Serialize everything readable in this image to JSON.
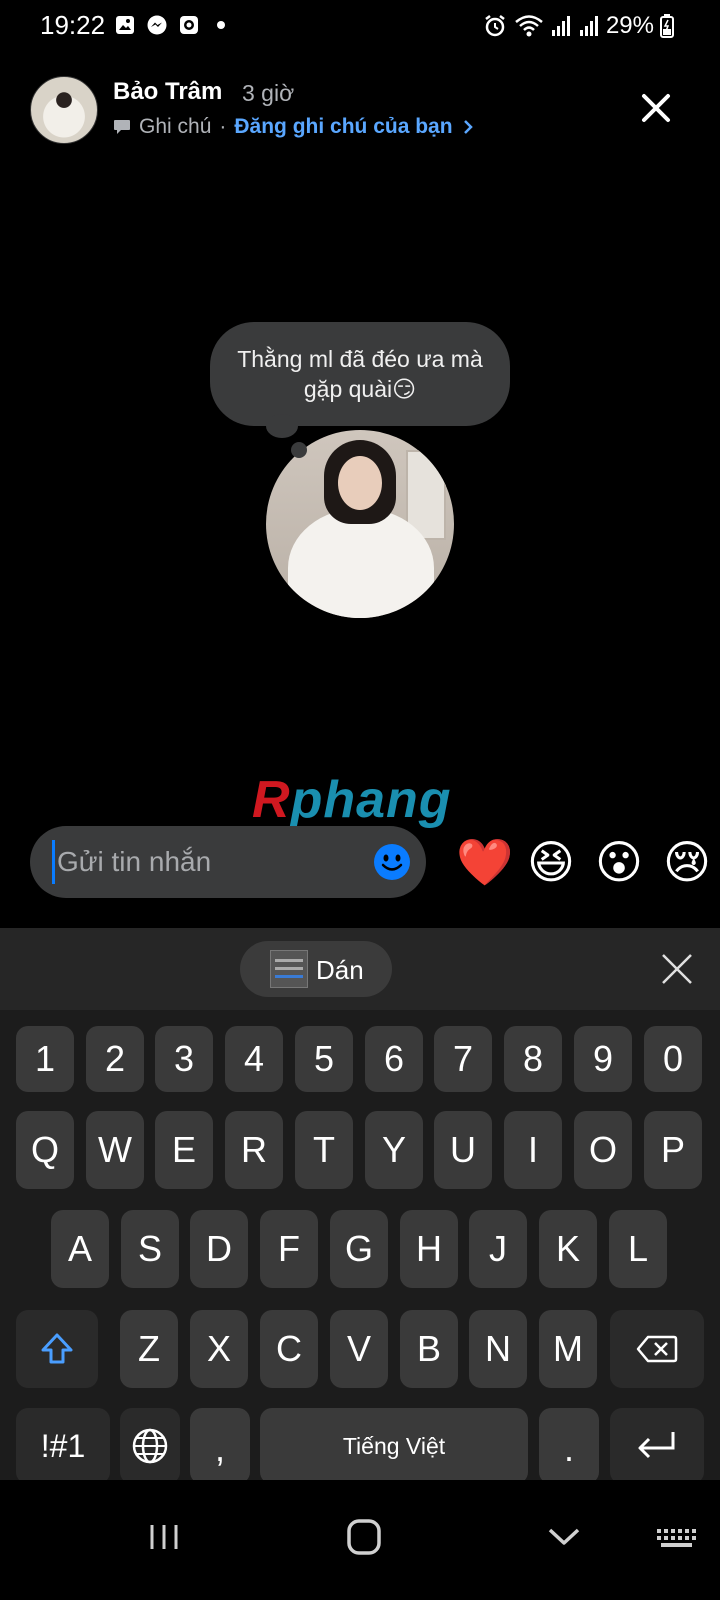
{
  "status_bar": {
    "time": "19:22",
    "battery": "29%"
  },
  "header": {
    "name": "Bảo Trâm",
    "time_ago": "3 giờ",
    "note_label": "Ghi chú",
    "separator": "·",
    "post_note_link": "Đăng ghi chú của bạn"
  },
  "note": {
    "text": "Thằng ml đã đéo ưa mà gặp quài😏"
  },
  "watermark": {
    "first": "R",
    "rest": "phang"
  },
  "composer": {
    "placeholder": "Gửi tin nhắn"
  },
  "reactions": [
    "❤️",
    "😆",
    "😮",
    "😢"
  ],
  "keyboard": {
    "paste_label": "Dán",
    "number_row": [
      "1",
      "2",
      "3",
      "4",
      "5",
      "6",
      "7",
      "8",
      "9",
      "0"
    ],
    "row1": [
      "Q",
      "W",
      "E",
      "R",
      "T",
      "Y",
      "U",
      "I",
      "O",
      "P"
    ],
    "row2": [
      "A",
      "S",
      "D",
      "F",
      "G",
      "H",
      "J",
      "K",
      "L"
    ],
    "row3": [
      "Z",
      "X",
      "C",
      "V",
      "B",
      "N",
      "M"
    ],
    "symbols_label": "!#1",
    "comma": ",",
    "space_label": "Tiếng Việt",
    "period": "."
  },
  "colors": {
    "accent_link": "#5aa7ff",
    "messenger_blue": "#0a7cff",
    "bubble_bg": "#3a3b3c"
  },
  "icons": [
    "image-icon",
    "messenger-icon",
    "screen-record-icon",
    "alarm-icon",
    "wifi-icon",
    "signal-icon",
    "battery-icon",
    "note-icon",
    "close-icon",
    "emoji-icon",
    "clipboard-thumbnail",
    "shift-icon",
    "backspace-icon",
    "globe-icon",
    "enter-icon",
    "recents-icon",
    "home-icon",
    "back-icon",
    "keyboard-icon"
  ]
}
